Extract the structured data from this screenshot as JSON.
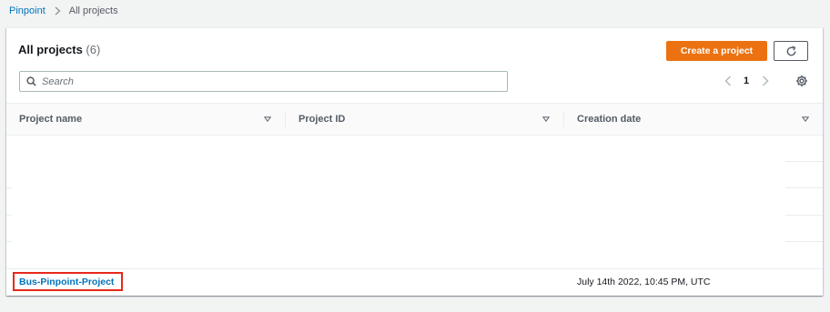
{
  "breadcrumb": {
    "root": "Pinpoint",
    "current": "All projects"
  },
  "panel": {
    "title": "All projects",
    "count": "(6)",
    "create_button": "Create a project"
  },
  "search": {
    "placeholder": "Search",
    "value": ""
  },
  "pagination": {
    "current_page": "1"
  },
  "table": {
    "columns": [
      "Project name",
      "Project ID",
      "Creation date"
    ],
    "rows": [
      {
        "project_name": "Bus-Pinpoint-Project",
        "project_id": "",
        "creation_date": "July 14th 2022, 10:45 PM, UTC"
      }
    ]
  },
  "colors": {
    "accent": "#ec7211",
    "link": "#0073bb",
    "highlight": "#e8291b"
  },
  "icons": {
    "breadcrumb_separator": "chevron-right-icon",
    "refresh": "refresh-icon",
    "search": "search-icon",
    "prev_page": "chevron-left-icon",
    "next_page": "chevron-right-icon",
    "settings": "gear-icon",
    "sort": "caret-down-icon"
  }
}
